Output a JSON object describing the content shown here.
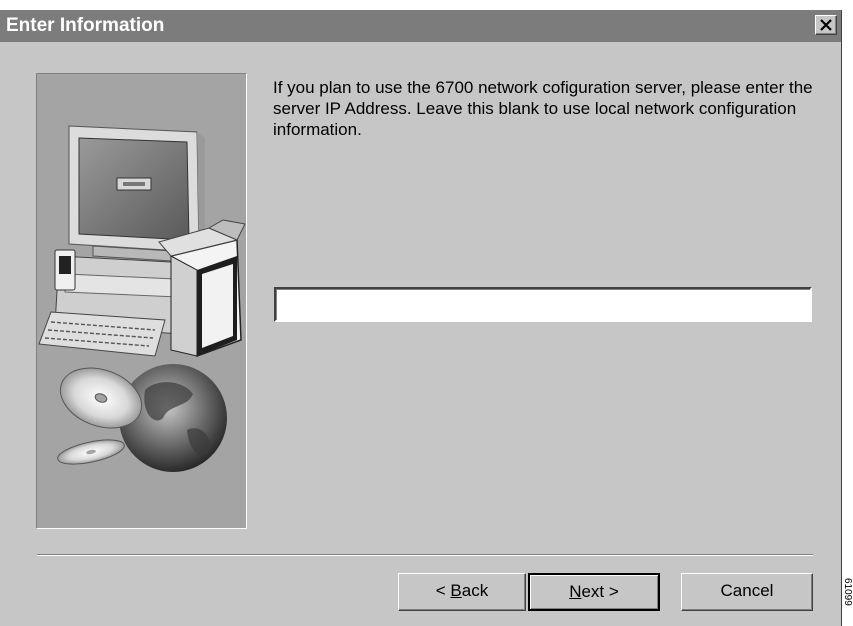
{
  "window": {
    "title": "Enter Information",
    "close_icon": "close-icon"
  },
  "main": {
    "instruction_text": "If you plan to use the 6700 network cofiguration server, please enter the server IP Address. Leave this blank to use local network configuration information.",
    "ip_address_value": "",
    "ip_address_placeholder": ""
  },
  "buttons": {
    "back": {
      "prefix": "< ",
      "mnemonic": "B",
      "rest": "ack"
    },
    "next": {
      "mnemonic": "N",
      "rest": "ext >"
    },
    "cancel_label": "Cancel"
  },
  "illustration": {
    "description_icons": [
      "computer-monitor-icon",
      "keyboard-icon",
      "software-box-icon",
      "cd-disc-icon",
      "globe-icon"
    ]
  },
  "figure_id": "61099",
  "colors": {
    "titlebar": "#7c7c7c",
    "dialog_face": "#c6c6c6",
    "side_panel": "#a4a4a4"
  }
}
